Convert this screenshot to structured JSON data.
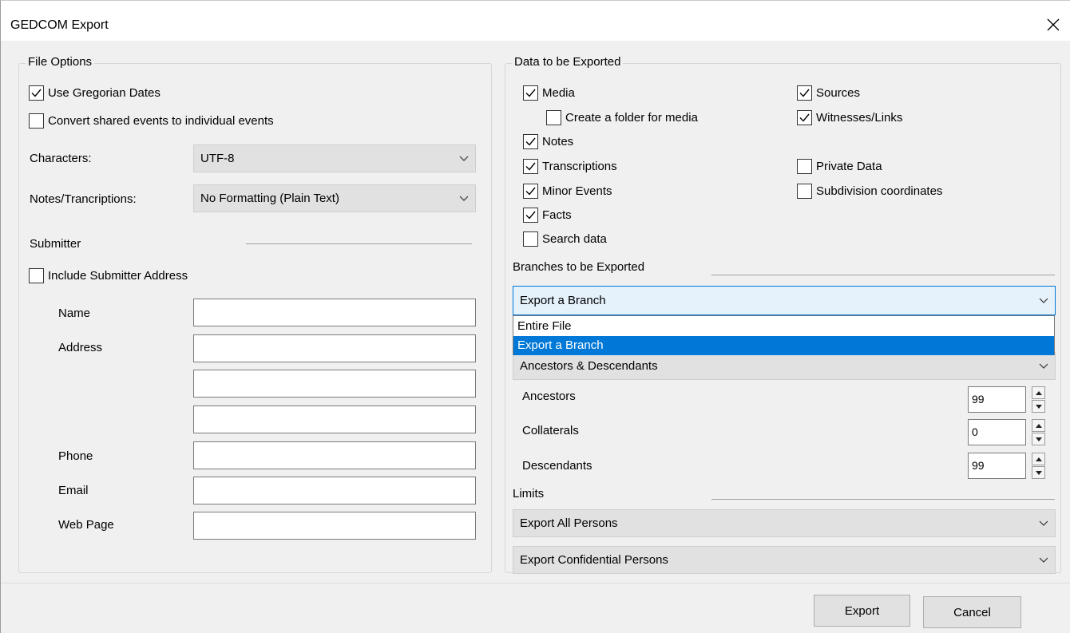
{
  "window": {
    "title": "GEDCOM Export",
    "close_glyph": "✕"
  },
  "file_options": {
    "legend": "File Options",
    "use_gregorian_dates": {
      "label": "Use Gregorian Dates",
      "checked": true
    },
    "convert_shared_events": {
      "label": "Convert shared events to individual events",
      "checked": false
    },
    "characters": {
      "label": "Characters:",
      "value": "UTF-8"
    },
    "notes_transcriptions": {
      "label": "Notes/Trancriptions:",
      "value": "No Formatting (Plain Text)"
    },
    "submitter": {
      "heading": "Submitter",
      "include_address": {
        "label": "Include Submitter Address",
        "checked": false
      },
      "name_label": "Name",
      "address_label": "Address",
      "phone_label": "Phone",
      "email_label": "Email",
      "web_page_label": "Web Page"
    }
  },
  "data_exported": {
    "legend": "Data to be Exported",
    "media": {
      "label": "Media",
      "checked": true
    },
    "create_folder": {
      "label": "Create a folder for media",
      "checked": false
    },
    "notes": {
      "label": "Notes",
      "checked": true
    },
    "transcriptions": {
      "label": "Transcriptions",
      "checked": true
    },
    "minor_events": {
      "label": "Minor Events",
      "checked": true
    },
    "facts": {
      "label": "Facts",
      "checked": true
    },
    "search_data": {
      "label": "Search data",
      "checked": false
    },
    "sources": {
      "label": "Sources",
      "checked": true
    },
    "witnesses_links": {
      "label": "Witnesses/Links",
      "checked": true
    },
    "private_data": {
      "label": "Private Data",
      "checked": false
    },
    "subdivision_coordinates": {
      "label": "Subdivision coordinates",
      "checked": false
    }
  },
  "branches": {
    "heading": "Branches to be Exported",
    "selected": "Export a Branch",
    "options": [
      "Entire File",
      "Export a Branch"
    ],
    "branch_type": "Ancestors & Descendants",
    "ancestors": {
      "label": "Ancestors",
      "value": "99"
    },
    "collaterals": {
      "label": "Collaterals",
      "value": "0"
    },
    "descendants": {
      "label": "Descendants",
      "value": "99"
    }
  },
  "limits": {
    "heading": "Limits",
    "persons": "Export All Persons",
    "confidential": "Export Confidential Persons"
  },
  "buttons": {
    "export": "Export",
    "cancel": "Cancel"
  }
}
